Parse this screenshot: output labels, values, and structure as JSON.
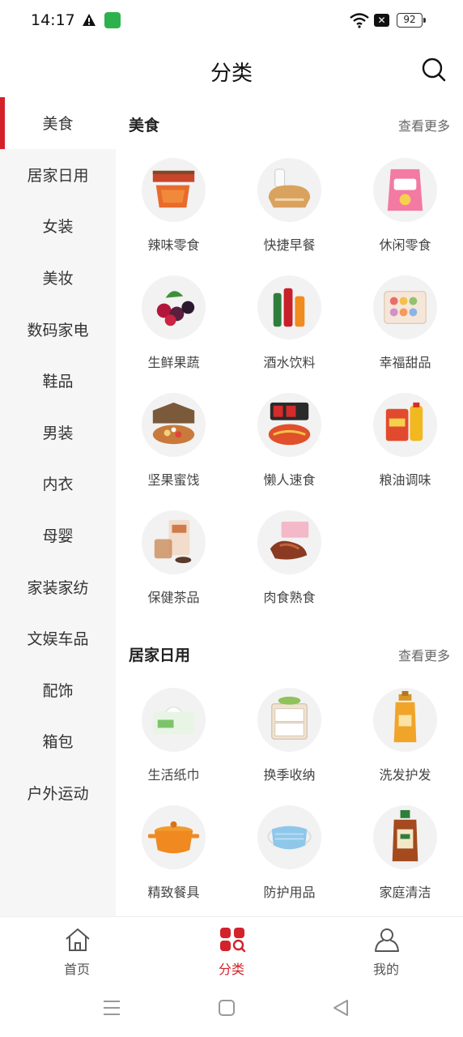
{
  "status_bar": {
    "time": "14:17",
    "battery": "92"
  },
  "header": {
    "title": "分类"
  },
  "sidebar": {
    "items": [
      {
        "label": "美食"
      },
      {
        "label": "居家日用"
      },
      {
        "label": "女装"
      },
      {
        "label": "美妆"
      },
      {
        "label": "数码家电"
      },
      {
        "label": "鞋品"
      },
      {
        "label": "男装"
      },
      {
        "label": "内衣"
      },
      {
        "label": "母婴"
      },
      {
        "label": "家装家纺"
      },
      {
        "label": "文娱车品"
      },
      {
        "label": "配饰"
      },
      {
        "label": "箱包"
      },
      {
        "label": "户外运动"
      }
    ],
    "active_index": 0
  },
  "sections": [
    {
      "title": "美食",
      "more": "查看更多",
      "items": [
        {
          "label": "辣味零食",
          "icon": "spicy-snack-image"
        },
        {
          "label": "快捷早餐",
          "icon": "bread-milk-image"
        },
        {
          "label": "休闲零食",
          "icon": "chips-bag-image"
        },
        {
          "label": "生鲜果蔬",
          "icon": "berries-image"
        },
        {
          "label": "酒水饮料",
          "icon": "drink-bottles-image"
        },
        {
          "label": "幸福甜品",
          "icon": "macaron-box-image"
        },
        {
          "label": "坚果蜜饯",
          "icon": "nut-gift-box-image"
        },
        {
          "label": "懒人速食",
          "icon": "instant-noodle-image"
        },
        {
          "label": "粮油调味",
          "icon": "rice-oil-image"
        },
        {
          "label": "保健茶品",
          "icon": "tea-box-image"
        },
        {
          "label": "肉食熟食",
          "icon": "cooked-meat-image"
        }
      ]
    },
    {
      "title": "居家日用",
      "more": "查看更多",
      "items": [
        {
          "label": "生活纸巾",
          "icon": "tissue-pack-image"
        },
        {
          "label": "换季收纳",
          "icon": "storage-drawer-image"
        },
        {
          "label": "洗发护发",
          "icon": "shampoo-bottle-image"
        },
        {
          "label": "精致餐具",
          "icon": "cooking-pot-image"
        },
        {
          "label": "防护用品",
          "icon": "face-mask-image"
        },
        {
          "label": "家庭清洁",
          "icon": "disinfectant-bottle-image"
        }
      ]
    }
  ],
  "tabbar": {
    "items": [
      {
        "label": "首页",
        "icon": "home-icon"
      },
      {
        "label": "分类",
        "icon": "category-icon"
      },
      {
        "label": "我的",
        "icon": "user-icon"
      }
    ],
    "active_index": 1
  },
  "colors": {
    "accent": "#d3222a",
    "sidebar_bg": "#f6f6f6"
  }
}
